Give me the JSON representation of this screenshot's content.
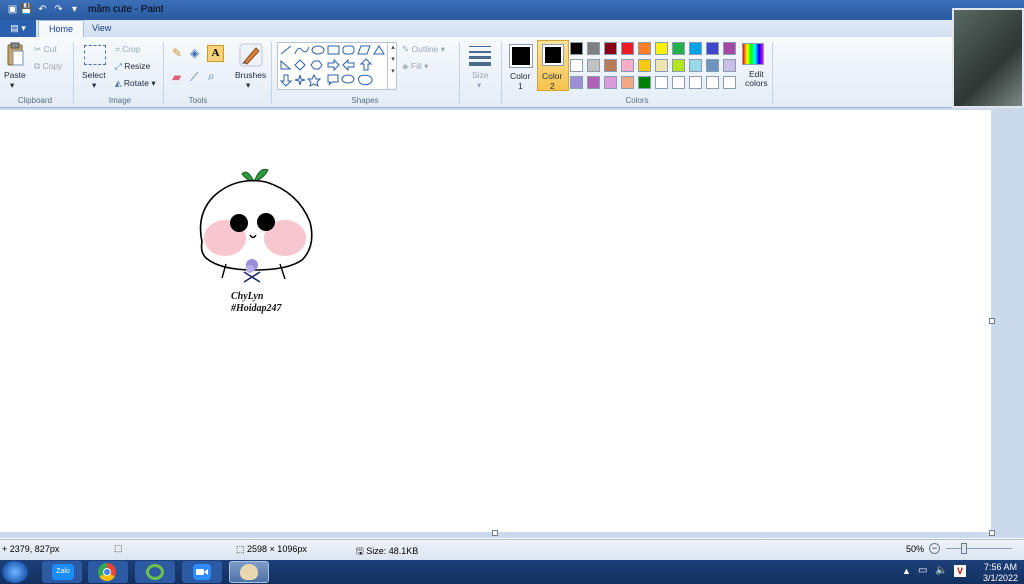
{
  "window": {
    "title": "mầm cute - Paint"
  },
  "tabs": [
    {
      "label": "Home"
    },
    {
      "label": "View"
    }
  ],
  "ribbon": {
    "clipboard": {
      "paste": "Paste",
      "cut": "Cut",
      "copy": "Copy",
      "group": "Clipboard"
    },
    "image": {
      "select": "Select",
      "crop": "Crop",
      "resize": "Resize",
      "rotate": "Rotate",
      "group": "Image"
    },
    "tools": {
      "group": "Tools"
    },
    "brushes": {
      "label": "Brushes"
    },
    "shapes": {
      "outline": "Outline",
      "fill": "Fill",
      "group": "Shapes"
    },
    "size": {
      "label": "Size"
    },
    "colors": {
      "color1": "Color",
      "color1_num": "1",
      "color2": "Color",
      "color2_num": "2",
      "edit": "Edit",
      "edit2": "colors",
      "group": "Colors",
      "palette_row1": [
        "#000000",
        "#7f7f7f",
        "#880015",
        "#ed1c24",
        "#ff7f27",
        "#fff200",
        "#22b14c",
        "#00a2e8",
        "#3f48cc",
        "#a349a4"
      ],
      "palette_row2": [
        "#ffffff",
        "#c3c3c3",
        "#b97a57",
        "#ffaec9",
        "#ffc90e",
        "#efe4b0",
        "#b5e61d",
        "#99d9ea",
        "#7092be",
        "#c8bfe7"
      ],
      "palette_row3": [
        "#9f8fd6",
        "#b25fb6",
        "#d99bd9",
        "#f5a982",
        "#008000",
        "#ffffff",
        "#ffffff",
        "#ffffff",
        "#ffffff",
        "#ffffff"
      ],
      "color1_value": "#000000",
      "color2_value": "#000000"
    }
  },
  "canvas": {
    "caption_line1": "ChyLyn",
    "caption_line2": "#Hoidap247"
  },
  "status": {
    "cursor_pos": "2379, 827px",
    "dimensions": "2598 × 1096px",
    "size": "Size: 48.1KB",
    "zoom": "50%"
  },
  "taskbar": {
    "zalo": "Zalo",
    "time": "7:56 AM",
    "date": "3/1/2022"
  }
}
